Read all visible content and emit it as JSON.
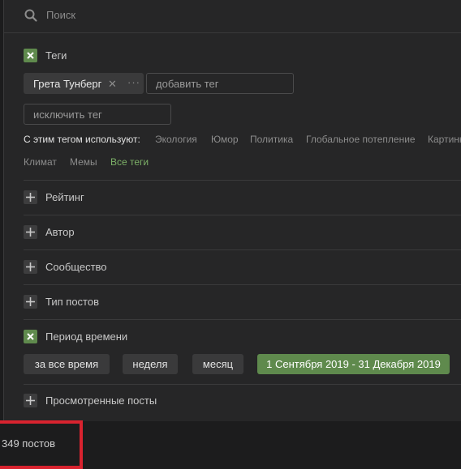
{
  "search": {
    "placeholder": "Поиск",
    "icon": "search-icon"
  },
  "tags": {
    "label": "Теги",
    "checked": true,
    "selected": [
      {
        "name": "Грета Тунберг"
      }
    ],
    "add_placeholder": "добавить тег",
    "exclude_placeholder": "исключить тег"
  },
  "related": {
    "heading": "С этим тегом используют:",
    "items": [
      "Экология",
      "Юмор",
      "Политика",
      "Глобальное потепление",
      "Картинки",
      "Климат",
      "Мемы"
    ],
    "all_link": "Все теги"
  },
  "sections": {
    "rating": "Рейтинг",
    "author": "Автор",
    "community": "Сообщество",
    "post_type": "Тип постов",
    "period": "Период времени",
    "viewed": "Просмотренные посты"
  },
  "period_options": [
    "за все время",
    "неделя",
    "месяц",
    "1 Сентября 2019 - 31 Декабря 2019"
  ],
  "period_selected": "1 Сентября 2019 - 31 Декабря 2019",
  "results": {
    "count": "349 постов"
  },
  "colors": {
    "accent": "#5f8a4d",
    "link": "#7cb067",
    "highlight": "#d8232f",
    "panel": "#262627"
  }
}
